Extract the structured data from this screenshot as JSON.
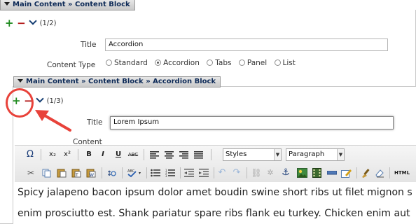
{
  "outer": {
    "breadcrumb": "Main Content » Content Block",
    "count": "(1/2)",
    "title_label": "Title",
    "title_value": "Accordion",
    "content_type_label": "Content Type",
    "content_type_options": [
      "Standard",
      "Accordion",
      "Tabs",
      "Panel",
      "List"
    ],
    "content_type_selected": "Accordion"
  },
  "inner": {
    "breadcrumb": "Main Content » Content Block » Accordion Block",
    "count": "(1/3)",
    "title_label": "Title",
    "title_value": "Lorem Ipsum",
    "content_label": "Content"
  },
  "toolbar": {
    "styles_value": "Styles",
    "format_value": "Paragraph",
    "underline": "U",
    "bold": "B",
    "italic": "I",
    "strike": "ABC",
    "subscript": "x₂",
    "superscript": "x²",
    "omega": "Ω",
    "html": "HTML"
  },
  "editor": {
    "lines": [
      "Spicy jalapeno bacon ipsum dolor amet boudin swine short ribs ut filet mignon s",
      "enim prosciutto est. Shank pariatur spare ribs flank eu turkey. Chicken enim aut"
    ]
  },
  "colors": {
    "plus": "#1e8a1e",
    "minus": "#b01111",
    "annotation": "#e8423a",
    "header_text": "#0d2a57"
  }
}
